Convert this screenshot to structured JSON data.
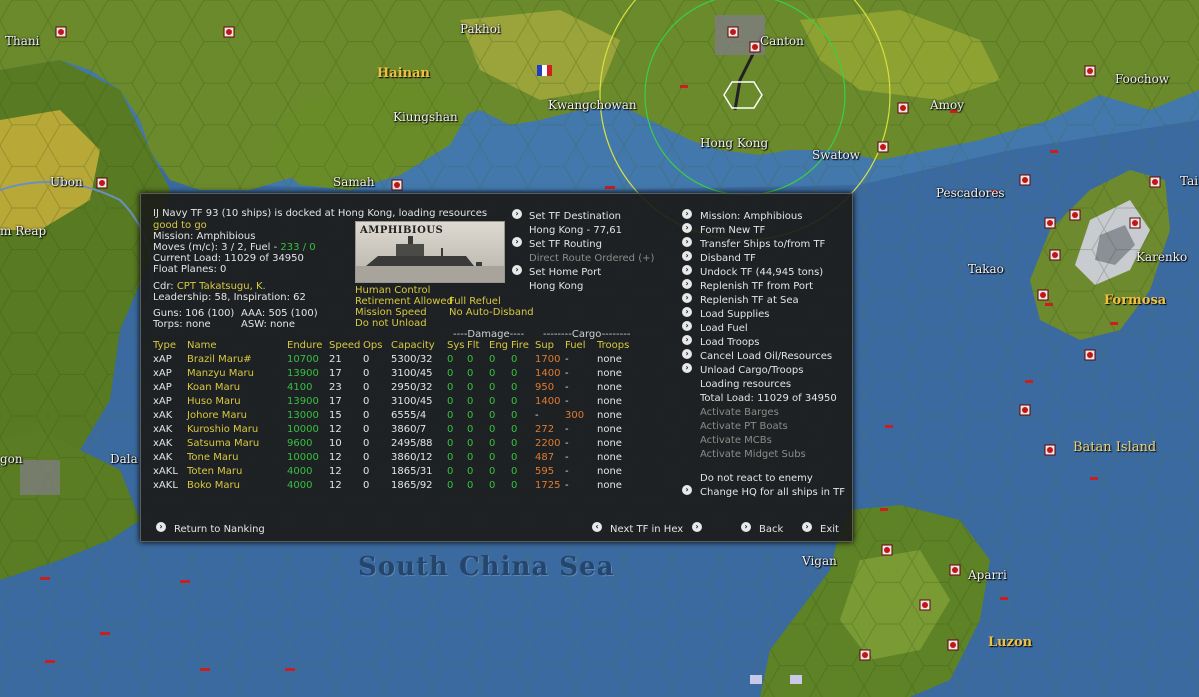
{
  "map": {
    "places": [
      "Thani",
      "Pakhoi",
      "Canton",
      "Foochow",
      "Kwangchowan",
      "Kiungshan",
      "Hong Kong",
      "Amoy",
      "Swatow",
      "Ubon",
      "Samah",
      "Pescadores",
      "Tai",
      "m Reap",
      "Takao",
      "Karenko",
      "Batan Island",
      "gon",
      "Dala",
      "Vigan",
      "Aparri"
    ],
    "regions": [
      "Hainan",
      "Formosa",
      "Luzon"
    ],
    "sea": "South China Sea"
  },
  "panel": {
    "header": "IJ Navy TF 93 (10 ships) is docked at Hong Kong, loading resources",
    "status": "good to go",
    "mission_line": "Mission: Amphibious",
    "moves": "Moves (m/c): 3 / 2, Fuel -",
    "fuel_value": "233 / 0",
    "current_load": "Current Load: 11029 of 34950",
    "float_planes": "Float Planes: 0",
    "cdr_label": "Cdr:",
    "cdr_name": "CPT Takatsugu, K.",
    "leadership": "Leadership: 58, Inspiration: 62",
    "guns": "Guns: 106 (100)",
    "aaa": "AAA: 505 (100)",
    "torps": "Torps: none",
    "asw": "ASW: none",
    "photo_caption": "AMPHIBIOUS",
    "human_control": "Human Control",
    "retirement": "Retirement Allowed",
    "full_refuel": "Full Refuel",
    "mission_speed": "Mission Speed",
    "auto_disband": "No Auto-Disband",
    "do_not_unload": "Do not Unload",
    "set_dest": "Set TF Destination",
    "dest_value": "Hong Kong - 77,61",
    "set_routing": "Set TF Routing",
    "direct_route": "Direct Route Ordered (+)",
    "set_home": "Set Home Port",
    "home_value": "Hong Kong",
    "damage_header": "----Damage----",
    "cargo_header": "--------Cargo--------",
    "columns": [
      "Type",
      "Name",
      "Endure",
      "Speed",
      "Ops",
      "Capacity",
      "Sys",
      "Flt",
      "Eng",
      "Fire",
      "Sup",
      "Fuel",
      "Troops"
    ],
    "ships": [
      {
        "type": "xAP",
        "name": "Brazil Maru#",
        "endure": "10700",
        "speed": "21",
        "ops": "0",
        "capacity": "5300/32",
        "sys": "0",
        "flt": "0",
        "eng": "0",
        "fire": "0",
        "sup": "1700",
        "fuel": "-",
        "troops": "none"
      },
      {
        "type": "xAP",
        "name": "Manzyu Maru",
        "endure": "13900",
        "speed": "17",
        "ops": "0",
        "capacity": "3100/45",
        "sys": "0",
        "flt": "0",
        "eng": "0",
        "fire": "0",
        "sup": "1400",
        "fuel": "-",
        "troops": "none"
      },
      {
        "type": "xAP",
        "name": "Koan Maru",
        "endure": "4100",
        "speed": "23",
        "ops": "0",
        "capacity": "2950/32",
        "sys": "0",
        "flt": "0",
        "eng": "0",
        "fire": "0",
        "sup": "950",
        "fuel": "-",
        "troops": "none"
      },
      {
        "type": "xAP",
        "name": "Huso Maru",
        "endure": "13900",
        "speed": "17",
        "ops": "0",
        "capacity": "3100/45",
        "sys": "0",
        "flt": "0",
        "eng": "0",
        "fire": "0",
        "sup": "1400",
        "fuel": "-",
        "troops": "none"
      },
      {
        "type": "xAK",
        "name": "Johore Maru",
        "endure": "13000",
        "speed": "15",
        "ops": "0",
        "capacity": "6555/4",
        "sys": "0",
        "flt": "0",
        "eng": "0",
        "fire": "0",
        "sup": "-",
        "fuel": "300",
        "troops": "none"
      },
      {
        "type": "xAK",
        "name": "Kuroshio Maru",
        "endure": "10000",
        "speed": "12",
        "ops": "0",
        "capacity": "3860/7",
        "sys": "0",
        "flt": "0",
        "eng": "0",
        "fire": "0",
        "sup": "272",
        "fuel": "-",
        "troops": "none"
      },
      {
        "type": "xAK",
        "name": "Satsuma Maru",
        "endure": "9600",
        "speed": "10",
        "ops": "0",
        "capacity": "2495/88",
        "sys": "0",
        "flt": "0",
        "eng": "0",
        "fire": "0",
        "sup": "2200",
        "fuel": "-",
        "troops": "none"
      },
      {
        "type": "xAK",
        "name": "Tone Maru",
        "endure": "10000",
        "speed": "12",
        "ops": "0",
        "capacity": "3860/12",
        "sys": "0",
        "flt": "0",
        "eng": "0",
        "fire": "0",
        "sup": "487",
        "fuel": "-",
        "troops": "none"
      },
      {
        "type": "xAKL",
        "name": "Toten Maru",
        "endure": "4000",
        "speed": "12",
        "ops": "0",
        "capacity": "1865/31",
        "sys": "0",
        "flt": "0",
        "eng": "0",
        "fire": "0",
        "sup": "595",
        "fuel": "-",
        "troops": "none"
      },
      {
        "type": "xAKL",
        "name": "Boko Maru",
        "endure": "4000",
        "speed": "12",
        "ops": "0",
        "capacity": "1865/92",
        "sys": "0",
        "flt": "0",
        "eng": "0",
        "fire": "0",
        "sup": "1725",
        "fuel": "-",
        "troops": "none"
      }
    ],
    "menu": [
      {
        "label": "Mission: Amphibious",
        "arrow": true,
        "dim": false
      },
      {
        "label": "Form New TF",
        "arrow": true,
        "dim": false
      },
      {
        "label": "Transfer Ships to/from TF",
        "arrow": true,
        "dim": false
      },
      {
        "label": "Disband TF",
        "arrow": true,
        "dim": false
      },
      {
        "label": "Undock TF (44,945 tons)",
        "arrow": true,
        "dim": false
      },
      {
        "label": "Replenish TF from Port",
        "arrow": true,
        "dim": false
      },
      {
        "label": "Replenish TF at Sea",
        "arrow": true,
        "dim": false
      },
      {
        "label": "Load Supplies",
        "arrow": true,
        "dim": false
      },
      {
        "label": "Load Fuel",
        "arrow": true,
        "dim": false
      },
      {
        "label": "Load Troops",
        "arrow": true,
        "dim": false
      },
      {
        "label": "Cancel Load Oil/Resources",
        "arrow": true,
        "dim": false
      },
      {
        "label": "Unload Cargo/Troops",
        "arrow": true,
        "dim": false
      },
      {
        "label": "Loading resources",
        "arrow": false,
        "dim": false
      },
      {
        "label": "Total Load: 11029 of 34950",
        "arrow": false,
        "dim": false
      },
      {
        "label": "Activate Barges",
        "arrow": false,
        "dim": true
      },
      {
        "label": "Activate PT Boats",
        "arrow": false,
        "dim": true
      },
      {
        "label": "Activate MCBs",
        "arrow": false,
        "dim": true
      },
      {
        "label": "Activate Midget Subs",
        "arrow": false,
        "dim": true
      }
    ],
    "no_react": "Do not react to enemy",
    "change_hq": "Change HQ for all ships in TF",
    "return": "Return to Nanking",
    "next_tf": "Next TF in Hex",
    "back": "Back",
    "exit": "Exit"
  },
  "colors": {
    "text_yellow": "#d8c840",
    "text_green": "#36c040",
    "text_orange": "#e07a30",
    "panel_bg": "#1c1c1a"
  }
}
